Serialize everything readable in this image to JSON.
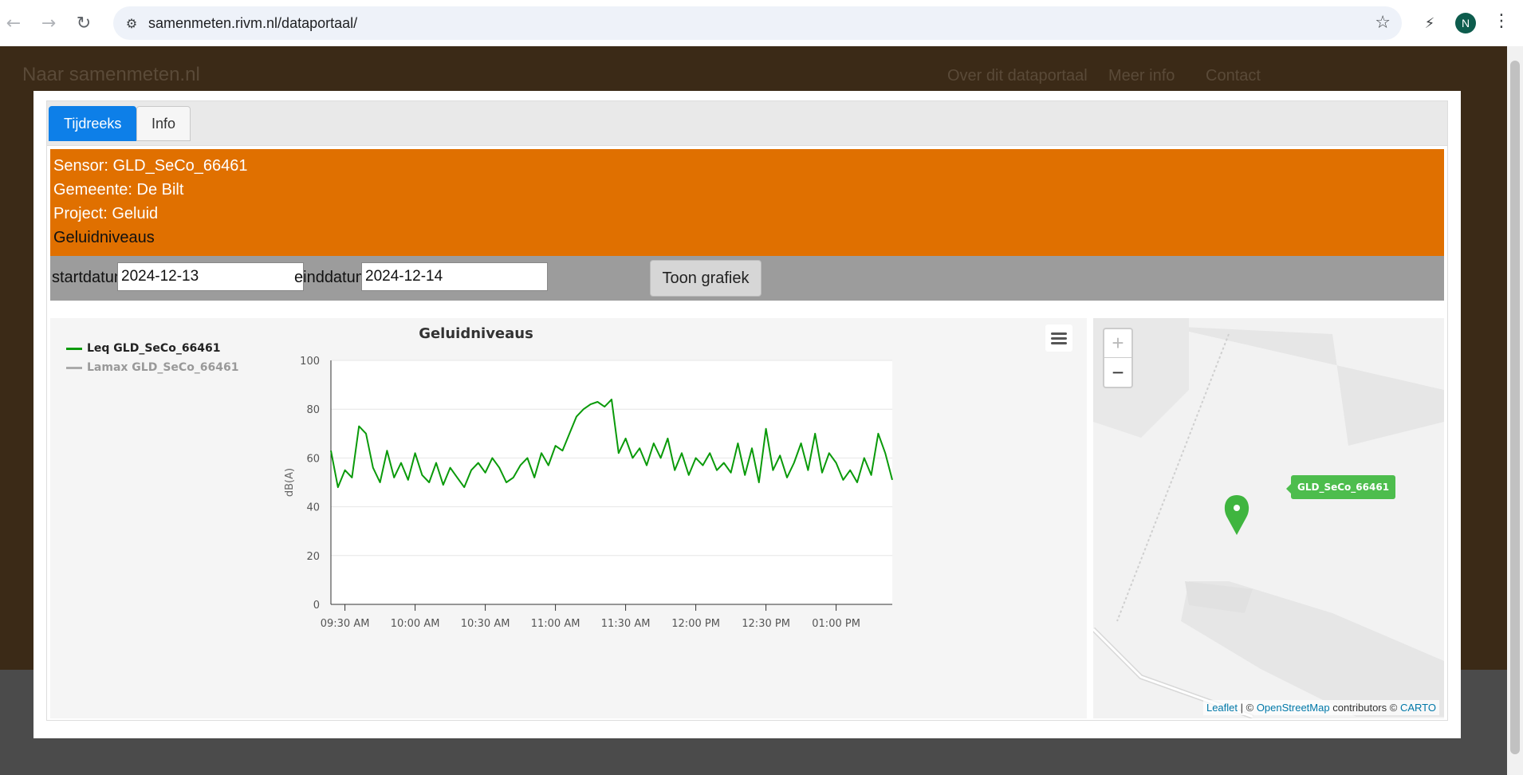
{
  "browser": {
    "url": "samenmeten.rivm.nl/dataportaal/",
    "avatar_initial": "N"
  },
  "site": {
    "title": "Naar samenmeten.nl",
    "nav": [
      "Over dit dataportaal",
      "Meer info",
      "Contact"
    ]
  },
  "modal": {
    "tabs": [
      {
        "label": "Tijdreeks",
        "active": true
      },
      {
        "label": "Info",
        "active": false
      }
    ],
    "info": {
      "sensor": "Sensor: GLD_SeCo_66461",
      "gemeente": "Gemeente: De Bilt",
      "project": "Project: Geluid",
      "type": "Geluidniveaus"
    },
    "dates": {
      "start_label": "startdatum",
      "start_value": "2024-12-13",
      "end_label": "einddatum",
      "end_value": "2024-12-14",
      "button_label": "Toon grafiek"
    }
  },
  "chart_data": {
    "type": "line",
    "title": "Geluidniveaus",
    "ylabel": "dB(A)",
    "xlabel": "",
    "ylim": [
      0,
      100
    ],
    "yticks": [
      0,
      20,
      40,
      60,
      80,
      100
    ],
    "xticks": [
      "09:30 AM",
      "10:00 AM",
      "10:30 AM",
      "11:00 AM",
      "11:30 AM",
      "12:00 PM",
      "12:30 PM",
      "01:00 PM"
    ],
    "x_range": [
      "09:24 AM",
      "01:24 PM"
    ],
    "grid": true,
    "legend_position": "top-left",
    "series": [
      {
        "name": "Leq GLD_SeCo_66461",
        "color": "#0a9a0a",
        "visible": true,
        "x": [
          "09:24 AM",
          "09:27 AM",
          "09:30 AM",
          "09:33 AM",
          "09:36 AM",
          "09:39 AM",
          "09:42 AM",
          "09:45 AM",
          "09:48 AM",
          "09:51 AM",
          "09:54 AM",
          "09:57 AM",
          "10:00 AM",
          "10:03 AM",
          "10:06 AM",
          "10:09 AM",
          "10:12 AM",
          "10:15 AM",
          "10:18 AM",
          "10:21 AM",
          "10:24 AM",
          "10:27 AM",
          "10:30 AM",
          "10:33 AM",
          "10:36 AM",
          "10:39 AM",
          "10:42 AM",
          "10:45 AM",
          "10:48 AM",
          "10:51 AM",
          "10:54 AM",
          "10:57 AM",
          "11:00 AM",
          "11:03 AM",
          "11:06 AM",
          "11:09 AM",
          "11:12 AM",
          "11:15 AM",
          "11:18 AM",
          "11:21 AM",
          "11:24 AM",
          "11:27 AM",
          "11:30 AM",
          "11:33 AM",
          "11:36 AM",
          "11:39 AM",
          "11:42 AM",
          "11:45 AM",
          "11:48 AM",
          "11:51 AM",
          "11:54 AM",
          "11:57 AM",
          "12:00 PM",
          "12:03 PM",
          "12:06 PM",
          "12:09 PM",
          "12:12 PM",
          "12:15 PM",
          "12:18 PM",
          "12:21 PM",
          "12:24 PM",
          "12:27 PM",
          "12:30 PM",
          "12:33 PM",
          "12:36 PM",
          "12:39 PM",
          "12:42 PM",
          "12:45 PM",
          "12:48 PM",
          "12:51 PM",
          "12:54 PM",
          "12:57 PM",
          "01:00 PM",
          "01:03 PM",
          "01:06 PM",
          "01:09 PM",
          "01:12 PM",
          "01:15 PM",
          "01:18 PM",
          "01:21 PM",
          "01:24 PM"
        ],
        "values": [
          63,
          48,
          55,
          52,
          73,
          70,
          56,
          50,
          63,
          52,
          58,
          51,
          62,
          53,
          50,
          58,
          49,
          56,
          52,
          48,
          55,
          58,
          54,
          60,
          56,
          50,
          52,
          57,
          60,
          52,
          62,
          57,
          65,
          63,
          70,
          77,
          80,
          82,
          83,
          81,
          84,
          62,
          68,
          60,
          64,
          57,
          66,
          60,
          68,
          55,
          62,
          53,
          60,
          57,
          62,
          55,
          58,
          54,
          66,
          53,
          64,
          50,
          72,
          55,
          61,
          52,
          58,
          66,
          55,
          70,
          54,
          62,
          58,
          51,
          55,
          50,
          60,
          53,
          70,
          62,
          51
        ]
      },
      {
        "name": "Lamax GLD_SeCo_66461",
        "color": "#aaaaaa",
        "visible": false,
        "x": [],
        "values": []
      }
    ]
  },
  "map": {
    "sensor_label": "GLD_SeCo_66461",
    "attribution_leaflet": "Leaflet",
    "attribution_osm": "OpenStreetMap",
    "attribution_contrib": "contributors ©",
    "attribution_carto": "CARTO",
    "marker_color": "#3fb53f"
  }
}
